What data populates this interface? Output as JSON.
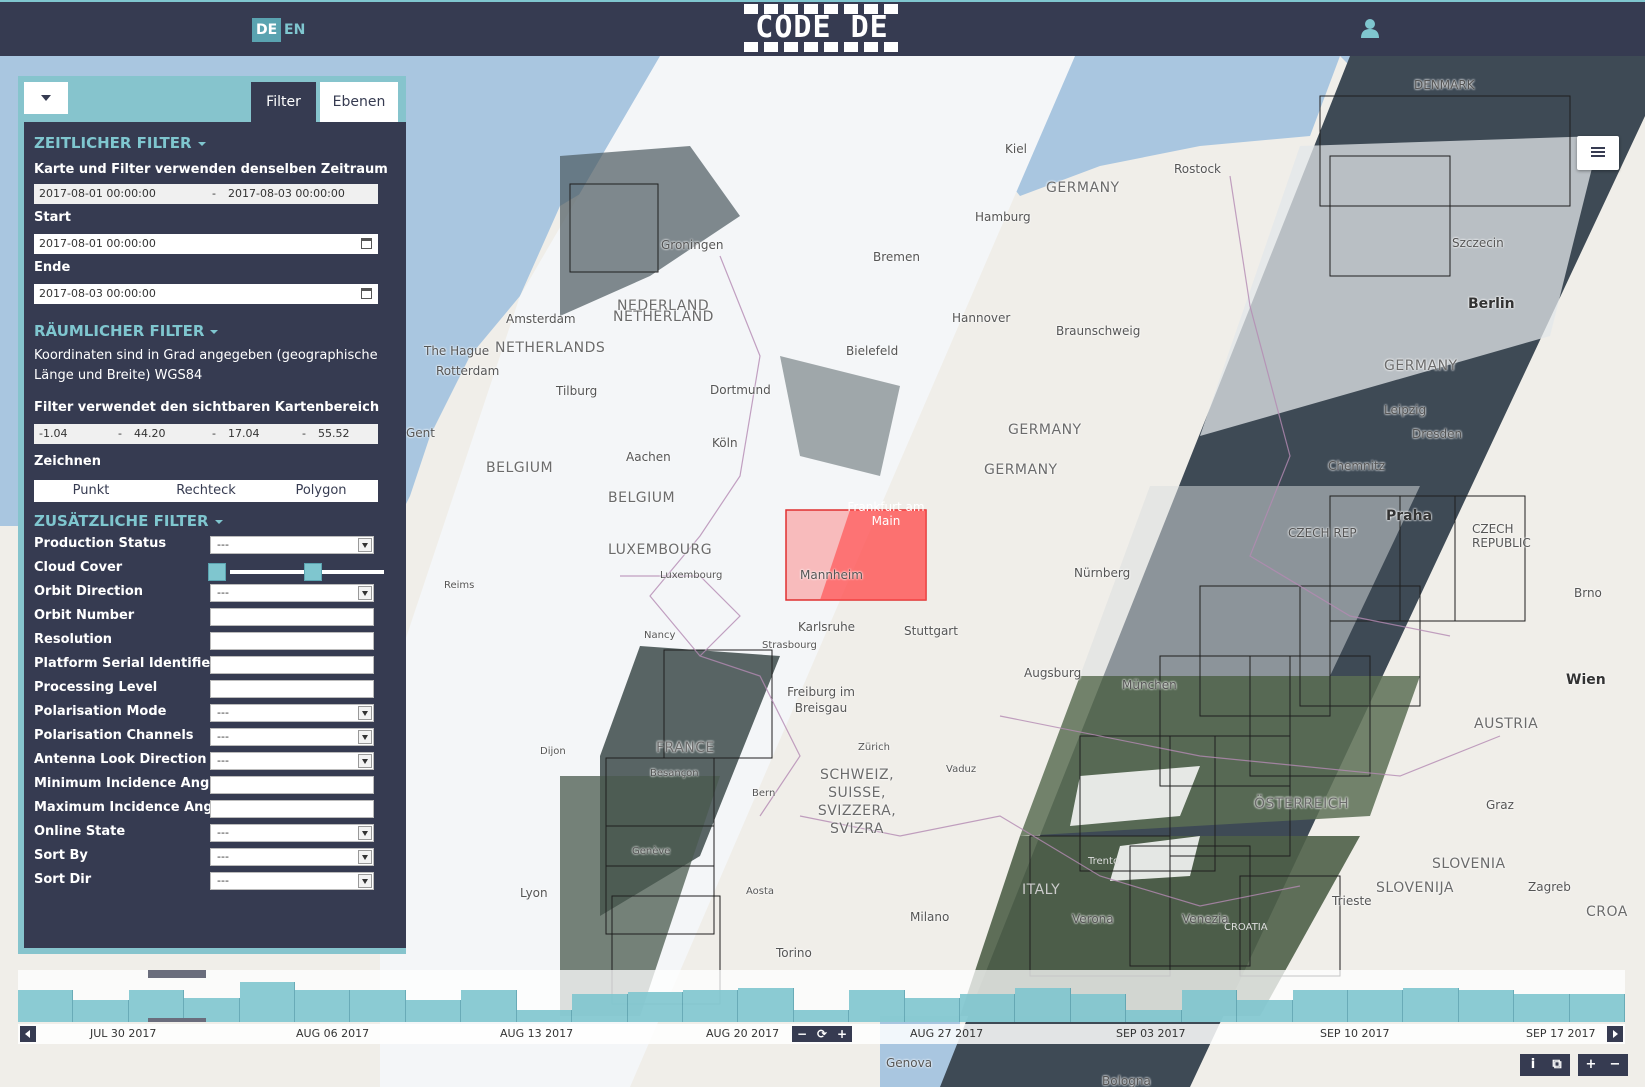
{
  "header": {
    "languages": [
      "DE",
      "EN"
    ],
    "active_language": "DE",
    "logo_text": "CODE DE"
  },
  "panel": {
    "tabs": [
      "Filter",
      "Ebenen"
    ],
    "active_tab": "Filter",
    "temporal": {
      "title": "ZEITLICHER FILTER",
      "note": "Karte und Filter verwenden denselben Zeitraum",
      "range_from": "2017-08-01 00:00:00",
      "range_sep": "-",
      "range_to": "2017-08-03 00:00:00",
      "start_label": "Start",
      "start_value": "2017-08-01 00:00:00",
      "end_label": "Ende",
      "end_value": "2017-08-03 00:00:00"
    },
    "spatial": {
      "title": "RÄUMLICHER FILTER",
      "note": "Koordinaten sind in Grad angegeben (geographische Länge und Breite) WGS84",
      "visible_area_label": "Filter verwendet den sichtbaren Kartenbereich",
      "bbox_values": [
        "-1.04",
        "44.20",
        "17.04",
        "55.52"
      ],
      "bbox_sep": "-",
      "draw_label": "Zeichnen",
      "draw_buttons": [
        "Punkt",
        "Rechteck",
        "Polygon"
      ]
    },
    "additional": {
      "title": "ZUSÄTZLICHE FILTER",
      "empty_option": "---",
      "fields": [
        {
          "label": "Production Status",
          "type": "select",
          "value": "---"
        },
        {
          "label": "Cloud Cover",
          "type": "slider",
          "value": ""
        },
        {
          "label": "Orbit Direction",
          "type": "select",
          "value": "---"
        },
        {
          "label": "Orbit Number",
          "type": "text",
          "value": ""
        },
        {
          "label": "Resolution",
          "type": "text",
          "value": ""
        },
        {
          "label": "Platform Serial Identifier",
          "type": "text",
          "value": ""
        },
        {
          "label": "Processing Level",
          "type": "text",
          "value": ""
        },
        {
          "label": "Polarisation Mode",
          "type": "select",
          "value": "---"
        },
        {
          "label": "Polarisation Channels",
          "type": "select",
          "value": "---"
        },
        {
          "label": "Antenna Look Direction",
          "type": "select",
          "value": "---"
        },
        {
          "label": "Minimum Incidence Angle",
          "type": "text",
          "value": ""
        },
        {
          "label": "Maximum Incidence Angle",
          "type": "text",
          "value": ""
        },
        {
          "label": "Online State",
          "type": "select",
          "value": "---"
        },
        {
          "label": "Sort By",
          "type": "select",
          "value": "---"
        },
        {
          "label": "Sort Dir",
          "type": "select",
          "value": "---"
        }
      ]
    }
  },
  "map": {
    "places": [
      "DENMARK",
      "Kiel",
      "Rostock",
      "GERMANY",
      "Hamburg",
      "Groningen",
      "Bremen",
      "Szczecin",
      "NEDERLAND",
      "NETHERLAND",
      "Amsterdam",
      "Hannover",
      "Braunschweig",
      "Berlin",
      "The Hague",
      "NETHERLANDS",
      "Bielefeld",
      "Rotterdam",
      "Tilburg",
      "Dortmund",
      "GERMANY",
      "Leipzig",
      "Gent",
      "Köln",
      "GERMANY",
      "Dresden",
      "Aachen",
      "BELGIUM",
      "GERMANY",
      "Chemnitz",
      "BELGIUM",
      "Frankfurt am Main",
      "Praha",
      "CZECH REP",
      "CZECH REPUBLIC",
      "LUXEMBOURG",
      "Luxembourg",
      "Mannheim",
      "Nürnberg",
      "Reims",
      "Karlsruhe",
      "Stuttgart",
      "Brno",
      "Nancy",
      "Strasbourg",
      "Augsburg",
      "Wien",
      "Freiburg im Breisgau",
      "München",
      "AUSTRIA",
      "Dijon",
      "FRANCE",
      "Zürich",
      "Vaduz",
      "Besançon",
      "SCHWEIZ, SUISSE, SVIZZERA, SVIZRA",
      "ÖSTERREICH",
      "Bern",
      "Graz",
      "SLOVENIA",
      "SLOVENIJA",
      "Zagreb",
      "Trento",
      "Genève",
      "ITALY",
      "Aosta",
      "Lyon",
      "Verona",
      "Venezia",
      "Trieste",
      "Milano",
      "Torino",
      "Genova",
      "Bologna",
      "CROATIA",
      "CROA"
    ]
  },
  "timeline": {
    "ticks": [
      "JUL 30 2017",
      "AUG 06 2017",
      "AUG 13 2017",
      "AUG 20 2017",
      "AUG 27 2017",
      "SEP 03 2017",
      "SEP 10 2017",
      "SEP 17 2017"
    ],
    "controls": [
      "−",
      "⟳",
      "+"
    ],
    "bar_levels": [
      0.8,
      0.55,
      0.8,
      0.6,
      1.0,
      0.8,
      0.8,
      0.55,
      0.8,
      0.3,
      0.7,
      0.75,
      0.8,
      0.85,
      0.3,
      0.8,
      0.6,
      0.7,
      0.85,
      0.7,
      0.3,
      0.8,
      0.55,
      0.8,
      0.8,
      0.85,
      0.8,
      0.7,
      0.7
    ]
  },
  "corner_controls": [
    "i",
    "⧉",
    "+",
    "−"
  ],
  "colors": {
    "primary": "#363b51",
    "accent": "#7fc6cf",
    "selection": "#ff4d4d"
  }
}
